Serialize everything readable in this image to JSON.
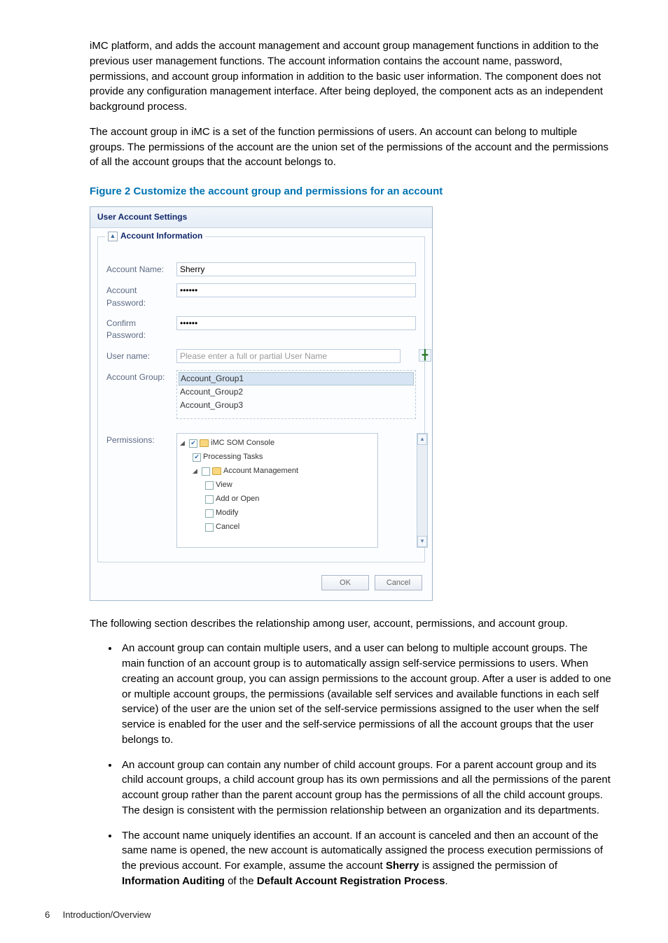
{
  "intro_p1": "iMC platform, and adds the account management and account group management functions in addition to the previous user management functions. The account information contains the account name, password, permissions, and account group information in addition to the basic user information. The component does not provide any configuration management interface. After being deployed, the component acts as an independent background process.",
  "intro_p2": "The account group in iMC is a set of the function permissions of users. An account can belong to multiple groups. The permissions of the account are the union set of the permissions of the account and the permissions of all the account groups that the account belongs to.",
  "figure_caption": "Figure 2 Customize the account group and permissions for an account",
  "dialog": {
    "title": "User Account Settings",
    "fieldset_legend": "Account Information",
    "labels": {
      "account_name": "Account Name:",
      "account_password": "Account Password:",
      "confirm_password": "Confirm Password:",
      "user_name": "User name:",
      "account_group": "Account Group:",
      "permissions": "Permissions:"
    },
    "values": {
      "account_name": "Sherry",
      "account_password": "••••••",
      "confirm_password": "••••••",
      "user_name_placeholder": "Please enter a full or partial User Name",
      "groups": [
        "Account_Group1",
        "Account_Group2",
        "Account_Group3"
      ],
      "tree": {
        "root": "iMC SOM Console",
        "n1": "Processing Tasks",
        "n2": "Account Management",
        "leafs": [
          "View",
          "Add or Open",
          "Modify",
          "Cancel"
        ]
      }
    },
    "buttons": {
      "ok": "OK",
      "cancel": "Cancel"
    }
  },
  "after_p": "The following section describes the relationship among user, account, permissions, and account group.",
  "bullets": {
    "b1": "An account group can contain multiple users, and a user can belong to multiple account groups. The main function of an account group is to automatically assign self-service permissions to users. When creating an account group, you can assign permissions to the account group. After a user is added to one or multiple account groups, the permissions (available self services and available functions in each self service) of the user are the union set of the self-service permissions assigned to the user when the self service is enabled for the user and the self-service permissions of all the account groups that the user belongs to.",
    "b2": "An account group can contain any number of child account groups. For a parent account group and its child account groups, a child account group has its own permissions and all the permissions of the parent account group rather than the parent account group has the permissions of all the child account groups. The design is consistent with the permission relationship between an organization and its departments.",
    "b3_pre": "The account name uniquely identifies an account. If an account is canceled and then an account of the same name is opened, the new account is automatically assigned the process execution permissions of the previous account. For example, assume the account ",
    "b3_bold1": "Sherry",
    "b3_mid1": " is assigned the permission of ",
    "b3_bold2": "Information Auditing",
    "b3_mid2": " of the ",
    "b3_bold3": "Default Account Registration Process",
    "b3_end": "."
  },
  "footer": {
    "page": "6",
    "section": "Introduction/Overview"
  }
}
